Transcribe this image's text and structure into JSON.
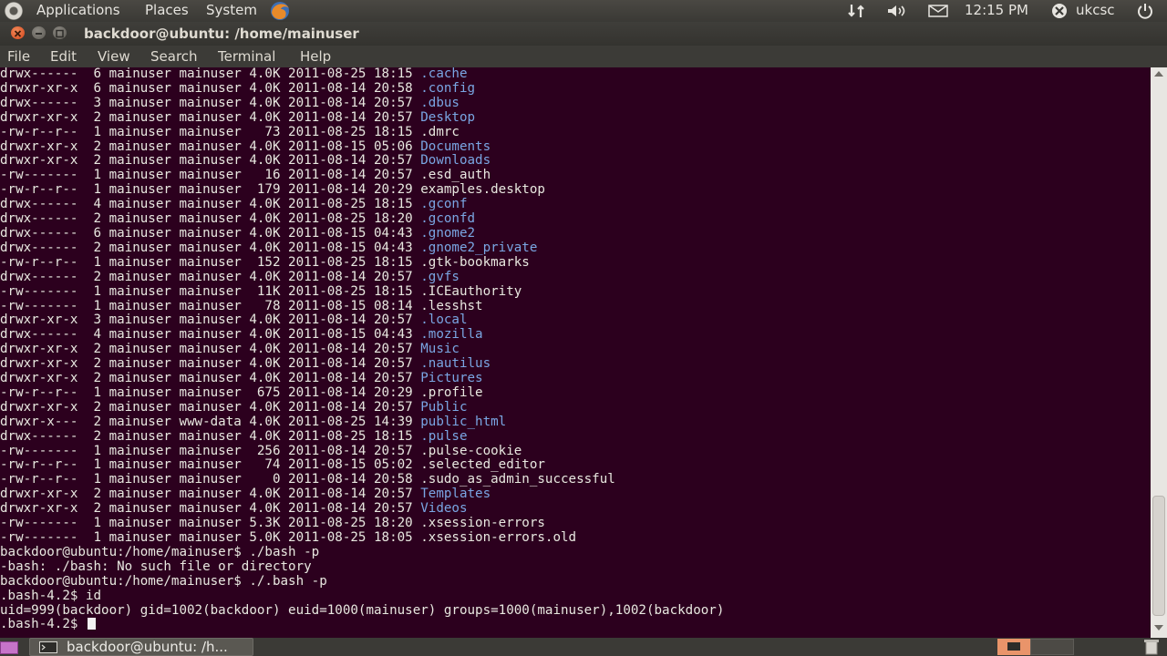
{
  "top_panel": {
    "menus": [
      "Applications",
      "Places",
      "System"
    ],
    "clock": "12:15 PM",
    "user": "ukcsc"
  },
  "window": {
    "title": "backdoor@ubuntu: /home/mainuser"
  },
  "menu": [
    "File",
    "Edit",
    "View",
    "Search",
    "Terminal",
    "Help"
  ],
  "terminal": {
    "lines": [
      {
        "info": "drwx------  6 mainuser mainuser 4.0K 2011-08-25 18:15 ",
        "name": ".cache",
        "dir": true
      },
      {
        "info": "drwxr-xr-x  6 mainuser mainuser 4.0K 2011-08-14 20:58 ",
        "name": ".config",
        "dir": true
      },
      {
        "info": "drwx------  3 mainuser mainuser 4.0K 2011-08-14 20:57 ",
        "name": ".dbus",
        "dir": true
      },
      {
        "info": "drwxr-xr-x  2 mainuser mainuser 4.0K 2011-08-14 20:57 ",
        "name": "Desktop",
        "dir": true
      },
      {
        "info": "-rw-r--r--  1 mainuser mainuser   73 2011-08-25 18:15 ",
        "name": ".dmrc",
        "dir": false
      },
      {
        "info": "drwxr-xr-x  2 mainuser mainuser 4.0K 2011-08-15 05:06 ",
        "name": "Documents",
        "dir": true
      },
      {
        "info": "drwxr-xr-x  2 mainuser mainuser 4.0K 2011-08-14 20:57 ",
        "name": "Downloads",
        "dir": true
      },
      {
        "info": "-rw-------  1 mainuser mainuser   16 2011-08-14 20:57 ",
        "name": ".esd_auth",
        "dir": false
      },
      {
        "info": "-rw-r--r--  1 mainuser mainuser  179 2011-08-14 20:29 ",
        "name": "examples.desktop",
        "dir": false
      },
      {
        "info": "drwx------  4 mainuser mainuser 4.0K 2011-08-25 18:15 ",
        "name": ".gconf",
        "dir": true
      },
      {
        "info": "drwx------  2 mainuser mainuser 4.0K 2011-08-25 18:20 ",
        "name": ".gconfd",
        "dir": true
      },
      {
        "info": "drwx------  6 mainuser mainuser 4.0K 2011-08-15 04:43 ",
        "name": ".gnome2",
        "dir": true
      },
      {
        "info": "drwx------  2 mainuser mainuser 4.0K 2011-08-15 04:43 ",
        "name": ".gnome2_private",
        "dir": true
      },
      {
        "info": "-rw-r--r--  1 mainuser mainuser  152 2011-08-25 18:15 ",
        "name": ".gtk-bookmarks",
        "dir": false
      },
      {
        "info": "drwx------  2 mainuser mainuser 4.0K 2011-08-14 20:57 ",
        "name": ".gvfs",
        "dir": true
      },
      {
        "info": "-rw-------  1 mainuser mainuser  11K 2011-08-25 18:15 ",
        "name": ".ICEauthority",
        "dir": false
      },
      {
        "info": "-rw-------  1 mainuser mainuser   78 2011-08-15 08:14 ",
        "name": ".lesshst",
        "dir": false
      },
      {
        "info": "drwxr-xr-x  3 mainuser mainuser 4.0K 2011-08-14 20:57 ",
        "name": ".local",
        "dir": true
      },
      {
        "info": "drwx------  4 mainuser mainuser 4.0K 2011-08-15 04:43 ",
        "name": ".mozilla",
        "dir": true
      },
      {
        "info": "drwxr-xr-x  2 mainuser mainuser 4.0K 2011-08-14 20:57 ",
        "name": "Music",
        "dir": true
      },
      {
        "info": "drwxr-xr-x  2 mainuser mainuser 4.0K 2011-08-14 20:57 ",
        "name": ".nautilus",
        "dir": true
      },
      {
        "info": "drwxr-xr-x  2 mainuser mainuser 4.0K 2011-08-14 20:57 ",
        "name": "Pictures",
        "dir": true
      },
      {
        "info": "-rw-r--r--  1 mainuser mainuser  675 2011-08-14 20:29 ",
        "name": ".profile",
        "dir": false
      },
      {
        "info": "drwxr-xr-x  2 mainuser mainuser 4.0K 2011-08-14 20:57 ",
        "name": "Public",
        "dir": true
      },
      {
        "info": "drwxr-x---  2 mainuser www-data 4.0K 2011-08-25 14:39 ",
        "name": "public_html",
        "dir": true
      },
      {
        "info": "drwx------  2 mainuser mainuser 4.0K 2011-08-25 18:15 ",
        "name": ".pulse",
        "dir": true
      },
      {
        "info": "-rw-------  1 mainuser mainuser  256 2011-08-14 20:57 ",
        "name": ".pulse-cookie",
        "dir": false
      },
      {
        "info": "-rw-r--r--  1 mainuser mainuser   74 2011-08-15 05:02 ",
        "name": ".selected_editor",
        "dir": false
      },
      {
        "info": "-rw-r--r--  1 mainuser mainuser    0 2011-08-14 20:58 ",
        "name": ".sudo_as_admin_successful",
        "dir": false
      },
      {
        "info": "drwxr-xr-x  2 mainuser mainuser 4.0K 2011-08-14 20:57 ",
        "name": "Templates",
        "dir": true
      },
      {
        "info": "drwxr-xr-x  2 mainuser mainuser 4.0K 2011-08-14 20:57 ",
        "name": "Videos",
        "dir": true
      },
      {
        "info": "-rw-------  1 mainuser mainuser 5.3K 2011-08-25 18:20 ",
        "name": ".xsession-errors",
        "dir": false
      },
      {
        "info": "-rw-------  1 mainuser mainuser 5.0K 2011-08-25 18:05 ",
        "name": ".xsession-errors.old",
        "dir": false
      },
      {
        "info": "backdoor@ubuntu:/home/mainuser$ ./bash -p",
        "name": "",
        "dir": false
      },
      {
        "info": "-bash: ./bash: No such file or directory",
        "name": "",
        "dir": false
      },
      {
        "info": "backdoor@ubuntu:/home/mainuser$ ./.bash -p",
        "name": "",
        "dir": false
      },
      {
        "info": ".bash-4.2$ id",
        "name": "",
        "dir": false
      },
      {
        "info": "uid=999(backdoor) gid=1002(backdoor) euid=1000(mainuser) groups=1000(mainuser),1002(backdoor)",
        "name": "",
        "dir": false
      },
      {
        "info": ".bash-4.2$ ",
        "name": "",
        "dir": false,
        "cursor": true
      }
    ]
  },
  "taskbar": {
    "label": "backdoor@ubuntu: /h..."
  },
  "colors": {
    "terminal_bg": "#2c001e",
    "terminal_fg": "#e8e8e0",
    "directory": "#7aa6e3"
  }
}
